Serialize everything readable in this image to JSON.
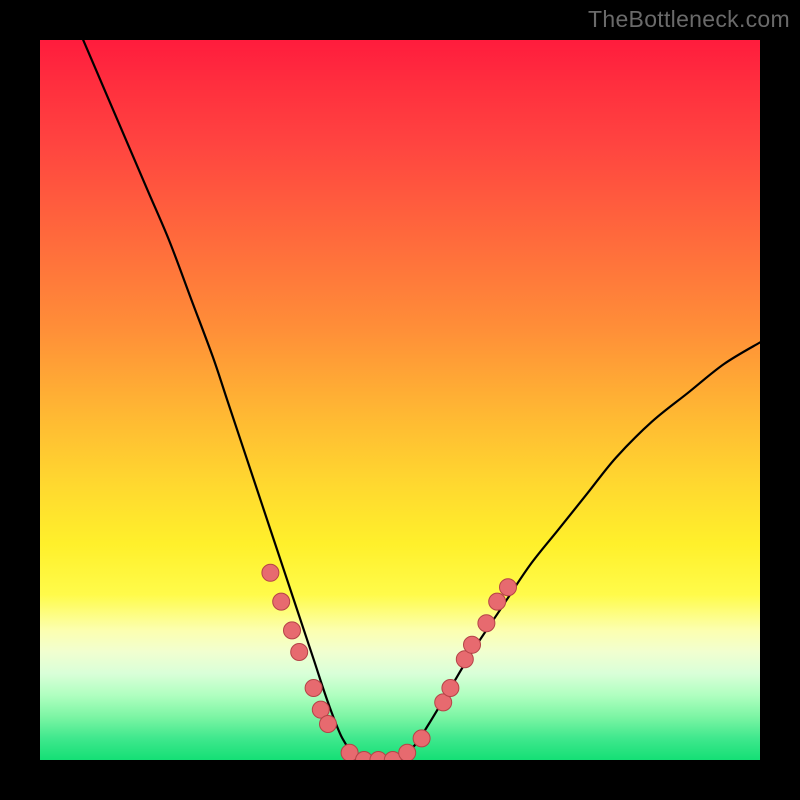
{
  "watermark": "TheBottleneck.com",
  "chart_data": {
    "type": "line",
    "title": "",
    "xlabel": "",
    "ylabel": "",
    "xlim": [
      0,
      100
    ],
    "ylim": [
      0,
      100
    ],
    "grid": false,
    "series": [
      {
        "name": "bottleneck-curve",
        "x": [
          6,
          9,
          12,
          15,
          18,
          21,
          24,
          26,
          28,
          30,
          32,
          34,
          36,
          38,
          40,
          42,
          44,
          46,
          48,
          50,
          52,
          54,
          57,
          60,
          64,
          68,
          72,
          76,
          80,
          85,
          90,
          95,
          100
        ],
        "y": [
          100,
          93,
          86,
          79,
          72,
          64,
          56,
          50,
          44,
          38,
          32,
          26,
          20,
          14,
          8,
          3,
          0.5,
          0,
          0,
          0.5,
          2,
          5,
          10,
          15,
          21,
          27,
          32,
          37,
          42,
          47,
          51,
          55,
          58
        ],
        "color": "#000000"
      }
    ],
    "markers": {
      "name": "highlight-points",
      "color": "#e76a6f",
      "points": [
        {
          "x": 32,
          "y": 26
        },
        {
          "x": 33.5,
          "y": 22
        },
        {
          "x": 35,
          "y": 18
        },
        {
          "x": 36,
          "y": 15
        },
        {
          "x": 38,
          "y": 10
        },
        {
          "x": 39,
          "y": 7
        },
        {
          "x": 40,
          "y": 5
        },
        {
          "x": 43,
          "y": 1
        },
        {
          "x": 45,
          "y": 0
        },
        {
          "x": 47,
          "y": 0
        },
        {
          "x": 49,
          "y": 0
        },
        {
          "x": 51,
          "y": 1
        },
        {
          "x": 53,
          "y": 3
        },
        {
          "x": 56,
          "y": 8
        },
        {
          "x": 57,
          "y": 10
        },
        {
          "x": 59,
          "y": 14
        },
        {
          "x": 60,
          "y": 16
        },
        {
          "x": 62,
          "y": 19
        },
        {
          "x": 63.5,
          "y": 22
        },
        {
          "x": 65,
          "y": 24
        }
      ]
    },
    "background_gradient": {
      "top": "#ff1c3d",
      "mid": "#fff02b",
      "bottom": "#14df75"
    }
  }
}
